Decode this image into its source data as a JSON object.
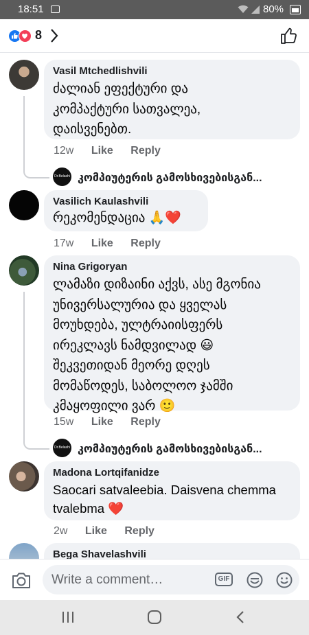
{
  "status_bar": {
    "time": "18:51",
    "battery_pct": "80%"
  },
  "header": {
    "reaction_count": "8"
  },
  "comments": [
    {
      "author": "Vasil Mtchedlishvili",
      "lines": [
        "ძალიან ეფექტური  და",
        "კომპაქტური სათვალეა,",
        "დაისვენებთ."
      ],
      "age": "12w",
      "like": "Like",
      "reply": "Reply"
    },
    {
      "author": "Vasilich Kaulashvili",
      "lines": [
        "რეკომენდაცია 🙏❤️"
      ],
      "age": "17w",
      "like": "Like",
      "reply": "Reply"
    },
    {
      "author": "Nina Grigoryan",
      "lines": [
        "ლამაზი დიზაინი აქვს, ასე მგონია",
        "უნივერსალურია და ყველას",
        "მოუხდება, ულტრაიისფერს",
        "ირეკლავს ნამდვილად 😃",
        "შეკვეთიდან მეორე დღეს",
        "მომაწოდეს, საბოლოო ჯამში",
        "კმაყოფილი ვარ 🙂"
      ],
      "age": "15w",
      "like": "Like",
      "reply": "Reply"
    },
    {
      "author": "Madona Lortqifanidze",
      "lines": [
        "Saocari satvaleebia. Daisvena chemma",
        "tvalebma ❤️"
      ],
      "age": "2w",
      "like": "Like",
      "reply": "Reply"
    },
    {
      "author": "Bega Shavelashvili"
    }
  ],
  "page_replies": [
    {
      "page_name": "კომპიუტერის გამოსხივებისგან...",
      "avatar_text": "Dr.Belashi"
    },
    {
      "page_name": "კომპიუტერის გამოსხივებისგან...",
      "avatar_text": "Dr.Belashi"
    }
  ],
  "composer": {
    "placeholder": "Write a comment…",
    "gif_label": "GIF"
  },
  "icons": [
    "camera-icon",
    "gif-icon",
    "sticker-icon",
    "emoji-icon",
    "like-thumb-icon",
    "chevron-right-icon",
    "back-icon",
    "home-icon",
    "recent-apps-icon"
  ],
  "colors": {
    "accent": "#1877f2",
    "love": "#f33e58",
    "bubble": "#f0f2f5",
    "meta_text": "#65676b"
  }
}
